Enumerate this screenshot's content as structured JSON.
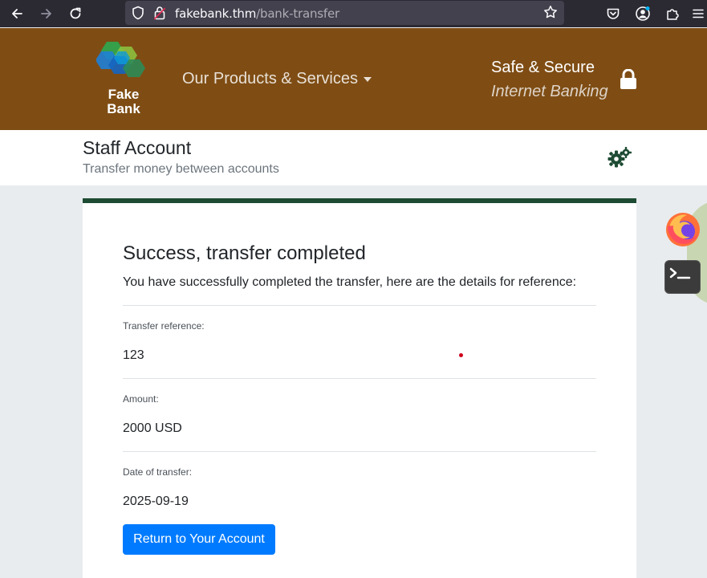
{
  "browser": {
    "url_domain": "fakebank.thm",
    "url_path": "/bank-transfer",
    "icons": [
      "back-arrow-icon",
      "forward-arrow-icon",
      "reload-icon",
      "shield-icon",
      "insecure-lock-icon",
      "bookmark-star-icon",
      "pocket-icon",
      "account-icon",
      "extensions-icon",
      "menu-icon"
    ]
  },
  "header": {
    "logo_line1": "Fake",
    "logo_line2": "Bank",
    "products_label": "Our Products & Services",
    "safe_label": "Safe & Secure",
    "ib_label": "Internet Banking",
    "background_color": "#7f4d14"
  },
  "account": {
    "title": "Staff Account",
    "subtitle": "Transfer money between accounts"
  },
  "transfer": {
    "title": "Success, transfer completed",
    "message": "You have successfully completed the transfer, here are the details for reference:",
    "reference_label": "Transfer reference:",
    "reference_value": "123",
    "amount_label": "Amount:",
    "amount_value": "2000 USD",
    "date_label": "Date of transfer:",
    "date_value": "2025-09-19",
    "return_button": "Return to Your Account",
    "accent_color": "#1e4b33",
    "button_color": "#007bff"
  },
  "dock": {
    "icons": [
      "firefox-icon",
      "terminal-icon"
    ]
  }
}
